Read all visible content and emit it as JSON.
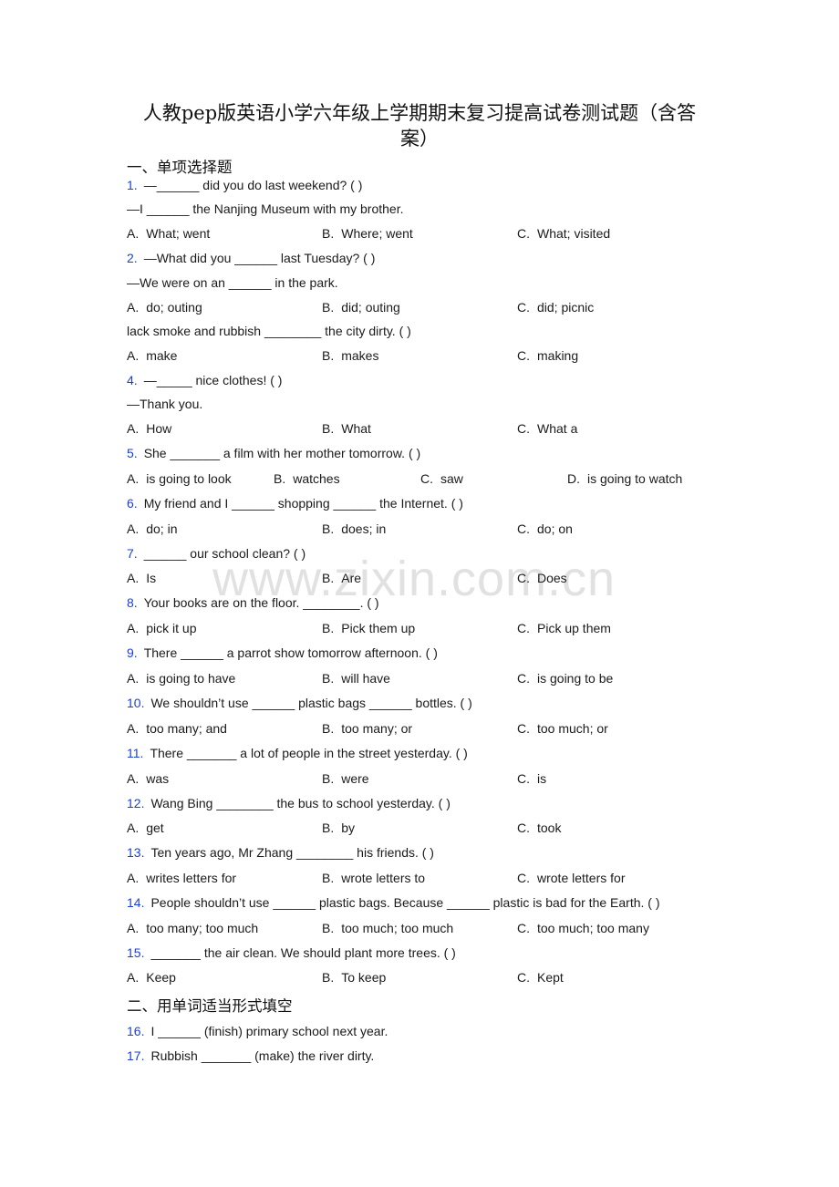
{
  "document": {
    "title_line1": "人教pep版英语小学六年级上学期期末复习提高试卷测试题（含答",
    "title_line2": "案）",
    "watermark": "www.zixin.com.cn",
    "number_color": "#1a3fd6"
  },
  "sections": [
    {
      "heading": "一、单项选择题"
    },
    {
      "heading": "二、用单词适当形式填空"
    }
  ],
  "questions": [
    {
      "num": "1.",
      "lines": [
        "—______ did you do last weekend? (    )",
        "—I ______ the Nanjing Museum with my brother."
      ],
      "options": [
        {
          "letter": "A.",
          "text": "What; went"
        },
        {
          "letter": "B.",
          "text": "Where; went"
        },
        {
          "letter": "C.",
          "text": "What; visited"
        }
      ]
    },
    {
      "num": "2.",
      "lines": [
        "—What did you ______ last Tuesday? (    )",
        "—We were on an ______ in the park."
      ],
      "options": [
        {
          "letter": "A.",
          "text": "do; outing"
        },
        {
          "letter": "B.",
          "text": "did; outing"
        },
        {
          "letter": "C.",
          "text": "did; picnic"
        }
      ]
    },
    {
      "num": "",
      "lines": [
        "lack smoke and rubbish ________ the city dirty. (     )"
      ],
      "options": [
        {
          "letter": "A.",
          "text": "make"
        },
        {
          "letter": "B.",
          "text": "makes"
        },
        {
          "letter": "C.",
          "text": "making"
        }
      ]
    },
    {
      "num": "4.",
      "lines": [
        "—_____ nice clothes! (    )",
        "—Thank you."
      ],
      "options": [
        {
          "letter": "A.",
          "text": "How"
        },
        {
          "letter": "B.",
          "text": "What"
        },
        {
          "letter": "C.",
          "text": "What a"
        }
      ]
    },
    {
      "num": "5.",
      "lines": [
        "She _______ a film with her mother tomorrow. (    )"
      ],
      "options": [
        {
          "letter": "A.",
          "text": "is going to look"
        },
        {
          "letter": "B.",
          "text": "watches"
        },
        {
          "letter": "C.",
          "text": "saw"
        },
        {
          "letter": "D.",
          "text": "is going to watch"
        }
      ]
    },
    {
      "num": "6.",
      "lines": [
        "My friend and I ______ shopping ______ the Internet. (   )"
      ],
      "options": [
        {
          "letter": "A.",
          "text": "do; in"
        },
        {
          "letter": "B.",
          "text": "does; in"
        },
        {
          "letter": "C.",
          "text": "do; on"
        }
      ]
    },
    {
      "num": "7.",
      "lines": [
        "______ our school clean? (   )"
      ],
      "options": [
        {
          "letter": "A.",
          "text": "Is"
        },
        {
          "letter": "B.",
          "text": "Are"
        },
        {
          "letter": "C.",
          "text": "Does"
        }
      ]
    },
    {
      "num": "8.",
      "lines": [
        "Your books are on the floor. ________. (     )"
      ],
      "options": [
        {
          "letter": "A.",
          "text": "pick it up"
        },
        {
          "letter": "B.",
          "text": "Pick them up"
        },
        {
          "letter": "C.",
          "text": "Pick up them"
        }
      ]
    },
    {
      "num": "9.",
      "lines": [
        "There ______ a parrot show tomorrow afternoon. (    )"
      ],
      "options": [
        {
          "letter": "A.",
          "text": "is going to have"
        },
        {
          "letter": "B.",
          "text": "will have"
        },
        {
          "letter": "C.",
          "text": "is going to be"
        }
      ]
    },
    {
      "num": "10.",
      "lines": [
        "We shouldn’t use ______ plastic bags ______ bottles. (    )"
      ],
      "options": [
        {
          "letter": "A.",
          "text": "too many; and"
        },
        {
          "letter": "B.",
          "text": "too many; or"
        },
        {
          "letter": "C.",
          "text": "too much; or"
        }
      ]
    },
    {
      "num": "11.",
      "lines": [
        "There _______ a lot of people in the street yesterday. (   )"
      ],
      "options": [
        {
          "letter": "A.",
          "text": "was"
        },
        {
          "letter": "B.",
          "text": "were"
        },
        {
          "letter": "C.",
          "text": "is"
        }
      ]
    },
    {
      "num": "12.",
      "lines": [
        "Wang Bing ________ the bus to school yesterday. (    )"
      ],
      "options": [
        {
          "letter": "A.",
          "text": "get"
        },
        {
          "letter": "B.",
          "text": "by"
        },
        {
          "letter": "C.",
          "text": "took"
        }
      ]
    },
    {
      "num": "13.",
      "lines": [
        "Ten years ago, Mr Zhang ________ his friends. (    )"
      ],
      "options": [
        {
          "letter": "A.",
          "text": "writes letters for"
        },
        {
          "letter": "B.",
          "text": "wrote letters to"
        },
        {
          "letter": "C.",
          "text": "wrote letters for"
        }
      ]
    },
    {
      "num": "14.",
      "lines": [
        "People shouldn’t use ______ plastic bags. Because ______ plastic is bad for the Earth. (    )"
      ],
      "options": [
        {
          "letter": "A.",
          "text": "too many; too much"
        },
        {
          "letter": "B.",
          "text": "too much; too much"
        },
        {
          "letter": "C.",
          "text": "too much; too many"
        }
      ]
    },
    {
      "num": "15.",
      "lines": [
        "_______ the air clean. We should plant more trees. (     )"
      ],
      "options": [
        {
          "letter": "A.",
          "text": "Keep"
        },
        {
          "letter": "B.",
          "text": "To keep"
        },
        {
          "letter": "C.",
          "text": "Kept"
        }
      ]
    }
  ],
  "fill_in": [
    {
      "num": "16.",
      "text": "I ______ (finish) primary school next year."
    },
    {
      "num": "17.",
      "text": "Rubbish _______ (make) the river dirty."
    }
  ]
}
